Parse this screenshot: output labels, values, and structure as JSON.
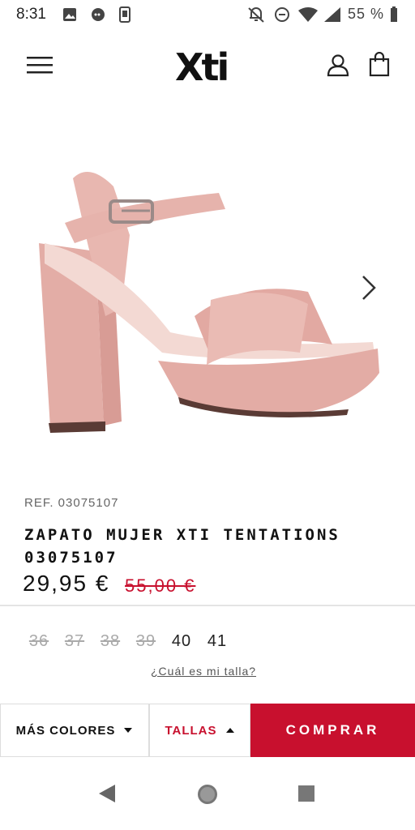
{
  "status_bar": {
    "time": "8:31",
    "battery": "55 %",
    "icons": [
      "image-icon",
      "message-icon",
      "phone-icon",
      "mute-icon",
      "dnd-icon",
      "wifi-icon",
      "signal-icon",
      "battery-icon"
    ]
  },
  "header": {
    "logo": "Xti",
    "icons": [
      "menu-icon",
      "user-icon",
      "bag-icon"
    ]
  },
  "product": {
    "ref": "REF. 03075107",
    "title": "ZAPATO MUJER XTI TENTATIONS 03075107",
    "price": "29,95 €",
    "old_price": "55,00 €",
    "sizes": [
      {
        "label": "36",
        "available": false
      },
      {
        "label": "37",
        "available": false
      },
      {
        "label": "38",
        "available": false
      },
      {
        "label": "39",
        "available": false
      },
      {
        "label": "40",
        "available": true
      },
      {
        "label": "41",
        "available": true
      }
    ],
    "size_help": "¿Cuál es mi talla?"
  },
  "bottom_bar": {
    "colors_label": "MÁS COLORES",
    "sizes_label": "TALLAS",
    "buy_label": "COMPRAR"
  },
  "colors": {
    "accent": "#c8102e",
    "shoe": "#e8b7b0"
  }
}
